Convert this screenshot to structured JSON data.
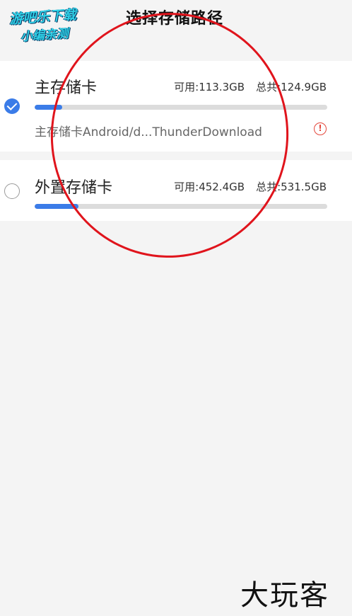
{
  "header": {
    "title": "选择存储路径",
    "back_icon": "chevron-left-icon"
  },
  "watermark": {
    "line1": "游吧乐下载",
    "line2": "小编亲测"
  },
  "storages": [
    {
      "name": "主存储卡",
      "available": "可用:113.3GB",
      "total": "总共:124.9GB",
      "selected": true,
      "used_fraction": 0.093,
      "path": "主存储卡Android/d...ThunderDownload",
      "warn_icon": "alert-circle-icon"
    },
    {
      "name": "外置存储卡",
      "available": "可用:452.4GB",
      "total": "总共:531.5GB",
      "selected": false,
      "used_fraction": 0.149
    }
  ],
  "footer_logo": "大玩客",
  "colors": {
    "accent": "#3b7ce8",
    "warning": "#e4473c",
    "annotation": "#e0141c"
  }
}
